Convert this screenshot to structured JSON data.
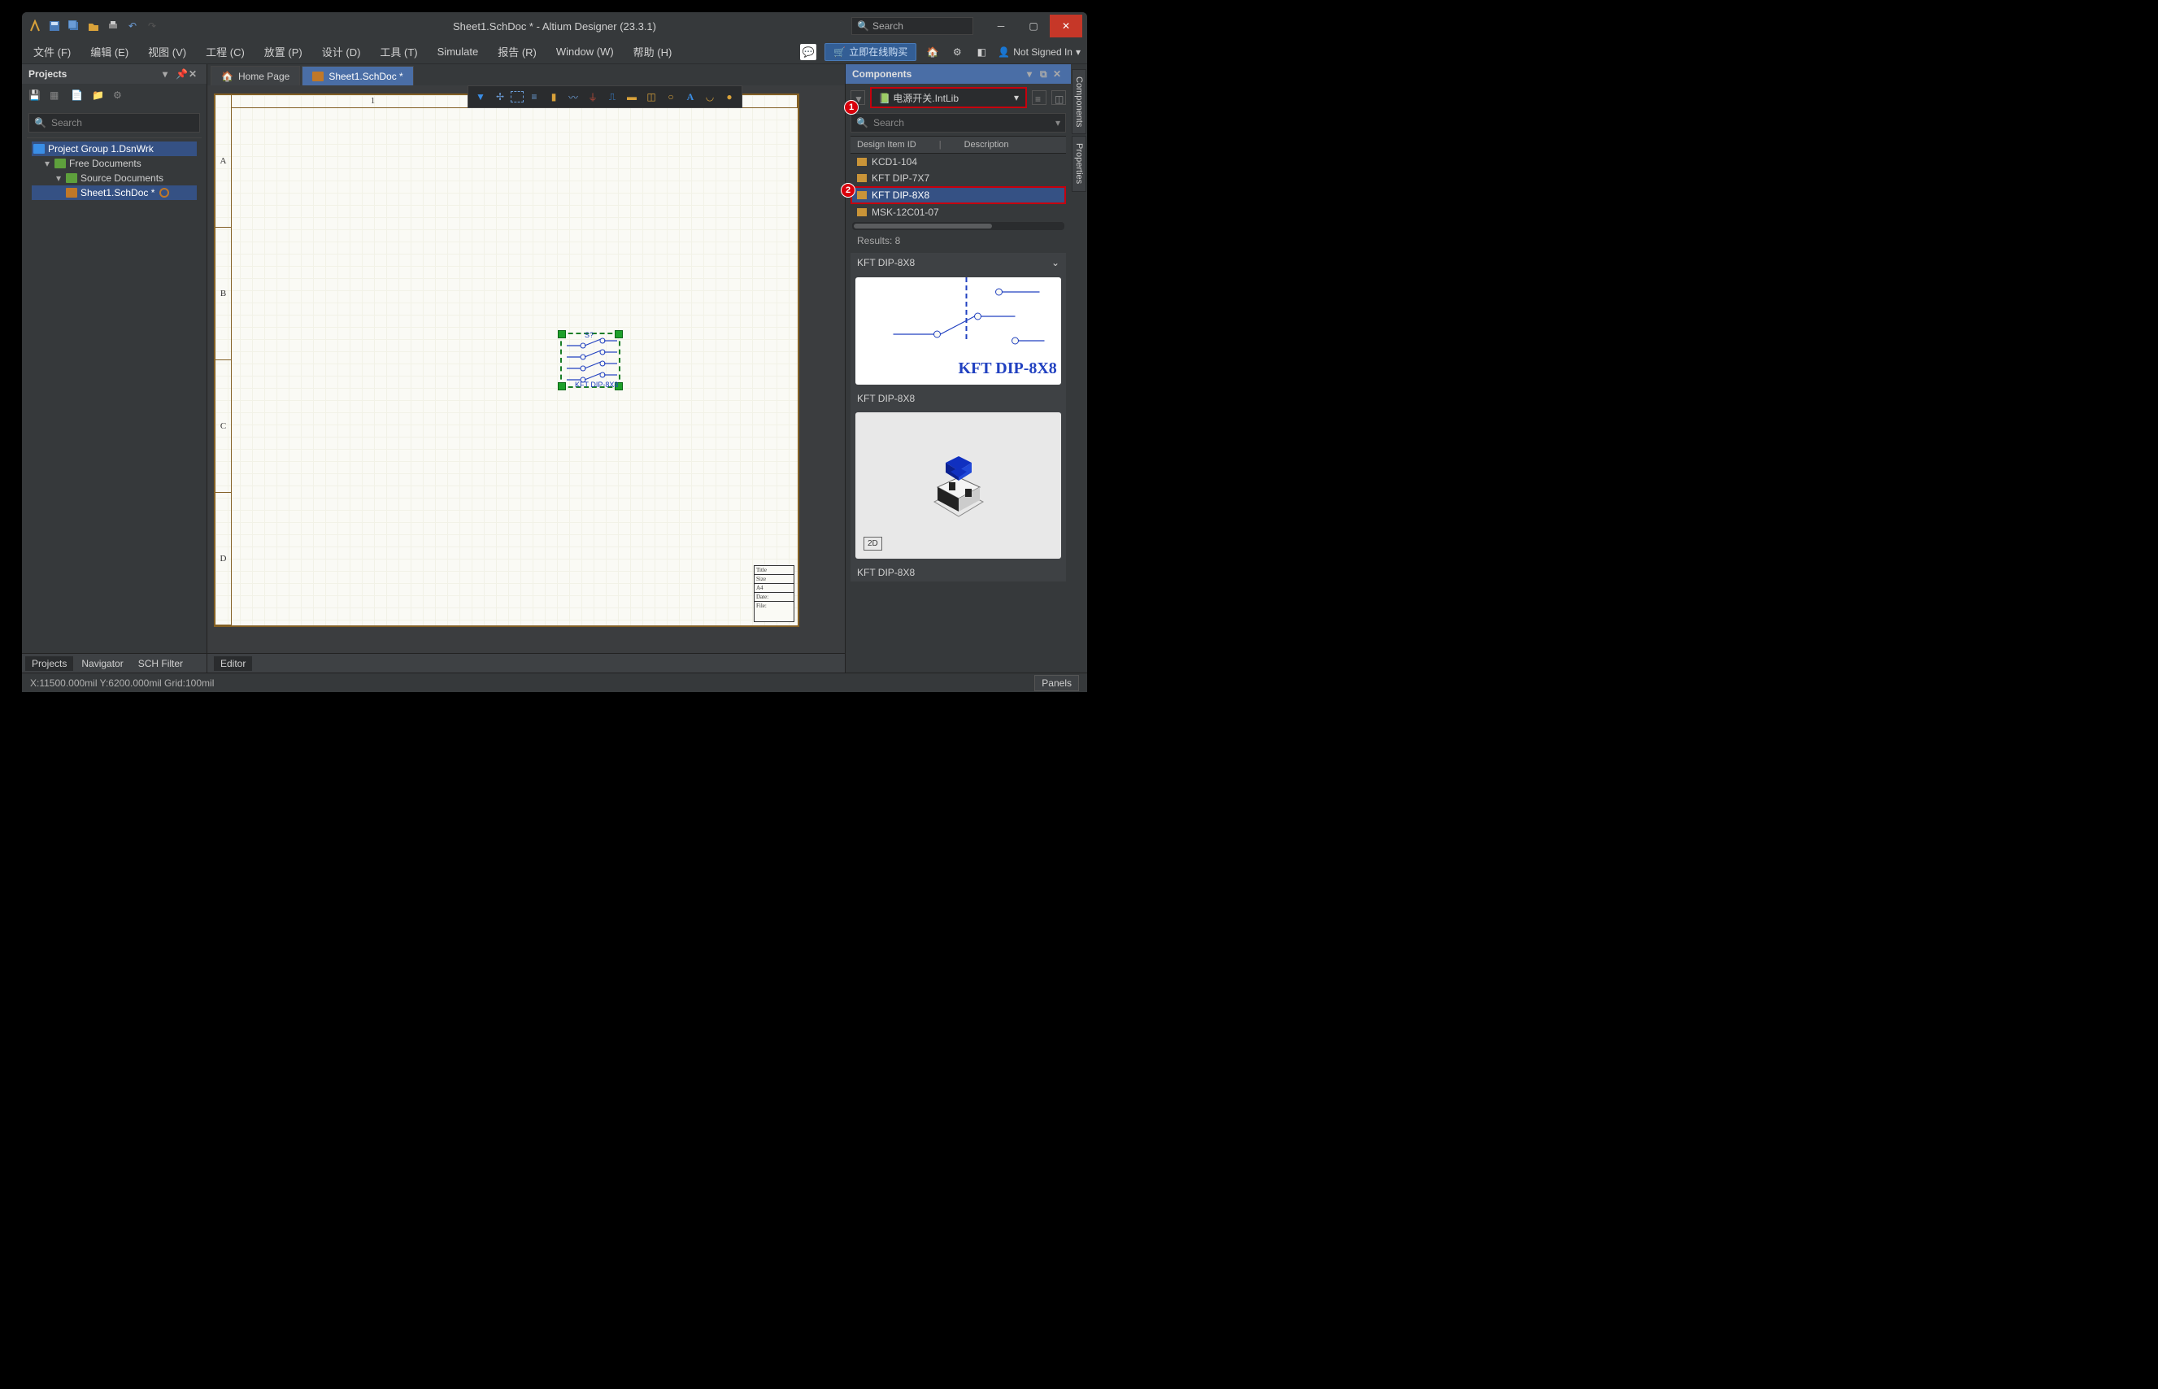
{
  "title": "Sheet1.SchDoc * - Altium Designer (23.3.1)",
  "global_search_placeholder": "Search",
  "menus": [
    "文件 (F)",
    "编辑 (E)",
    "视图 (V)",
    "工程 (C)",
    "放置 (P)",
    "设计 (D)",
    "工具 (T)",
    "Simulate",
    "报告 (R)",
    "Window (W)",
    "帮助 (H)"
  ],
  "buy_now": "立即在线购买",
  "signed_in": "Not Signed In",
  "projects_panel": {
    "title": "Projects",
    "search_placeholder": "Search",
    "group": "Project Group 1.DsnWrk",
    "free_docs": "Free Documents",
    "source_docs": "Source Documents",
    "doc": "Sheet1.SchDoc *",
    "tabs": [
      "Projects",
      "Navigator",
      "SCH Filter"
    ]
  },
  "doc_tabs": {
    "home": "Home Page",
    "active": "Sheet1.SchDoc *"
  },
  "sheet": {
    "rows": [
      "A",
      "B",
      "C",
      "D"
    ],
    "col": "1",
    "comp_designator": "S?",
    "comp_name": "KFT DIP-8X8",
    "title_block": {
      "title": "Title",
      "size": "Size",
      "a4": "A4",
      "date": "Date:",
      "file": "File:"
    }
  },
  "editor_tab": "Editor",
  "components_panel": {
    "title": "Components",
    "library": "电源开关.IntLib",
    "search_placeholder": "Search",
    "cols": {
      "id": "Design Item ID",
      "desc": "Description"
    },
    "items": [
      "KCD1-104",
      "KFT DIP-7X7",
      "KFT DIP-8X8",
      "MSK-12C01-07"
    ],
    "results": "Results: 8",
    "selected_header": "KFT DIP-8X8",
    "schem_label": "KFT DIP-8X8",
    "preview_label_1": "KFT DIP-8X8",
    "preview_label_2": "KFT DIP-8X8",
    "badge": "2D"
  },
  "vtabs": [
    "Components",
    "Properties"
  ],
  "status": {
    "coords": "X:11500.000mil Y:6200.000mil   Grid:100mil",
    "panels_btn": "Panels"
  },
  "callouts": {
    "one": "1",
    "two": "2"
  }
}
